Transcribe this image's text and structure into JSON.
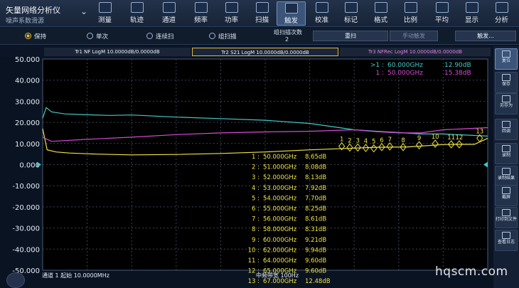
{
  "header": {
    "title": "矢量网络分析仪",
    "subtitle": "噪声系数滑源",
    "menu": [
      {
        "label": "测量",
        "icon": "measure-icon"
      },
      {
        "label": "轨迹",
        "icon": "trace-icon"
      },
      {
        "label": "通道",
        "icon": "channel-icon"
      },
      {
        "label": "频率",
        "icon": "frequency-icon"
      },
      {
        "label": "功率",
        "icon": "power-icon"
      },
      {
        "label": "扫描",
        "icon": "sweep-icon"
      },
      {
        "label": "触发",
        "icon": "trigger-icon",
        "active": true
      },
      {
        "label": "校准",
        "icon": "calibrate-icon"
      },
      {
        "label": "标记",
        "icon": "marker-icon"
      },
      {
        "label": "格式",
        "icon": "format-icon"
      },
      {
        "label": "比例",
        "icon": "scale-icon"
      },
      {
        "label": "平均",
        "icon": "average-icon"
      },
      {
        "label": "显示",
        "icon": "display-icon"
      },
      {
        "label": "分析",
        "icon": "analysis-icon"
      }
    ]
  },
  "trigger_bar": {
    "hold": "保持",
    "single": "单次",
    "continuous": "连续扫",
    "group": "组扫描",
    "group_count_label": "组扫描次数",
    "group_count_value": "2",
    "restart": "重扫",
    "manual": "手动触发",
    "trigger_more": "触发..."
  },
  "traces": {
    "tr1": "Tr1 NF LogM 10.0000dB/0.0000dB",
    "tr2": "Tr2 S21 LogM 10.0000dB/0.0000dB",
    "tr3": "Tr3 NFRec LogM 10.0000dB/0.0000dB"
  },
  "chart_data": {
    "type": "line",
    "ylim": [
      -50,
      50
    ],
    "y_ticks": [
      "50.000",
      "40.000",
      "30.000",
      "20.000",
      "10.000",
      "0.000",
      "-10.000",
      "-20.000",
      "-30.000",
      "-40.000",
      "-50.000"
    ],
    "reference_level": "0.000",
    "series": [
      {
        "name": "Tr1 NF",
        "color": "#f0e442",
        "start": "#f0e442",
        "points": [
          [
            0,
            17
          ],
          [
            0.01,
            7
          ],
          [
            0.03,
            6
          ],
          [
            0.06,
            5.5
          ],
          [
            0.12,
            5
          ],
          [
            0.2,
            4.6
          ],
          [
            0.3,
            4.8
          ],
          [
            0.4,
            5.3
          ],
          [
            0.5,
            6
          ],
          [
            0.6,
            7
          ],
          [
            0.7,
            7.8
          ],
          [
            0.75,
            8.2
          ],
          [
            0.82,
            8.4
          ],
          [
            0.9,
            9.5
          ],
          [
            0.95,
            9.6
          ],
          [
            0.97,
            9.6
          ],
          [
            1,
            12.5
          ]
        ]
      },
      {
        "name": "Tr2 S21",
        "color": "#45c8c8",
        "points": [
          [
            0,
            22
          ],
          [
            0.008,
            27
          ],
          [
            0.02,
            25
          ],
          [
            0.05,
            24
          ],
          [
            0.1,
            23.6
          ],
          [
            0.15,
            23.3
          ],
          [
            0.2,
            23.5
          ],
          [
            0.3,
            22.5
          ],
          [
            0.4,
            21.8
          ],
          [
            0.5,
            21
          ],
          [
            0.6,
            19.5
          ],
          [
            0.65,
            18
          ],
          [
            0.7,
            16.5
          ],
          [
            0.75,
            15.8
          ],
          [
            0.8,
            15.2
          ],
          [
            0.85,
            14.5
          ],
          [
            0.9,
            14.5
          ],
          [
            0.95,
            14
          ],
          [
            1,
            13.5
          ]
        ]
      },
      {
        "name": "Tr3 NFRec",
        "color": "#d44bd4",
        "points": [
          [
            0,
            13
          ],
          [
            0.02,
            11
          ],
          [
            0.1,
            12
          ],
          [
            0.2,
            13
          ],
          [
            0.3,
            14.2
          ],
          [
            0.4,
            15
          ],
          [
            0.5,
            15.5
          ],
          [
            0.6,
            15.8
          ],
          [
            0.7,
            16.5
          ],
          [
            0.75,
            15.6
          ],
          [
            0.8,
            15
          ],
          [
            0.85,
            15
          ],
          [
            0.9,
            16.5
          ],
          [
            0.95,
            17
          ],
          [
            1,
            17.5
          ]
        ]
      }
    ],
    "marker_readout": [
      {
        "id": "1",
        "freq": "50.000GHz",
        "value": "8.65dB"
      },
      {
        "id": "2",
        "freq": "51.000GHz",
        "value": "8.08dB"
      },
      {
        "id": "3",
        "freq": "52.000GHz",
        "value": "8.13dB"
      },
      {
        "id": "4",
        "freq": "53.000GHz",
        "value": "7.92dB"
      },
      {
        "id": "5",
        "freq": "54.000GHz",
        "value": "7.70dB"
      },
      {
        "id": "6",
        "freq": "55.000GHz",
        "value": "8.25dB"
      },
      {
        "id": "7",
        "freq": "56.000GHz",
        "value": "8.61dB"
      },
      {
        "id": "8",
        "freq": "58.000GHz",
        "value": "8.31dB"
      },
      {
        "id": "9",
        "freq": "60.000GHz",
        "value": "9.21dB"
      },
      {
        "id": "10",
        "freq": "62.000GHz",
        "value": "9.94dB"
      },
      {
        "id": "11",
        "freq": "64.000GHz",
        "value": "9.60dB"
      },
      {
        "id": "12",
        "freq": "65.000GHz",
        "value": "9.60dB"
      },
      {
        "id": "13",
        "freq": "67.000GHz",
        "value": "12.48dB"
      }
    ],
    "top_markers": [
      {
        "prefix": ">1",
        "freq": "60.000GHz",
        "value": "12.90dB",
        "color": "#45c8c8"
      },
      {
        "prefix": "1",
        "freq": "50.000GHz",
        "value": "15.38dB",
        "color": "#d44bd4"
      }
    ],
    "trace_markers": [
      {
        "label": "1",
        "x": 0.672,
        "y": 8.7
      },
      {
        "label": "2",
        "x": 0.69,
        "y": 8.1
      },
      {
        "label": "3",
        "x": 0.708,
        "y": 8.1
      },
      {
        "label": "4",
        "x": 0.726,
        "y": 7.9
      },
      {
        "label": "5",
        "x": 0.744,
        "y": 7.7
      },
      {
        "label": "6",
        "x": 0.762,
        "y": 8.3
      },
      {
        "label": "7",
        "x": 0.78,
        "y": 8.6
      },
      {
        "label": "8",
        "x": 0.81,
        "y": 8.3
      },
      {
        "label": "9",
        "x": 0.846,
        "y": 9.2
      },
      {
        "label": "10",
        "x": 0.882,
        "y": 9.9
      },
      {
        "label": "11",
        "x": 0.918,
        "y": 9.6
      },
      {
        "label": "12",
        "x": 0.936,
        "y": 9.6
      },
      {
        "label": "13",
        "x": 0.982,
        "y": 12.5
      }
    ]
  },
  "status": {
    "channel": "通道 1 起始 10.0000MHz",
    "ifbw": "中频带宽 100Hz"
  },
  "sidebar": [
    {
      "label": "复位",
      "icon": "reset-icon",
      "on": true
    },
    {
      "label": "保存",
      "icon": "save-icon"
    },
    {
      "label": "另存为",
      "icon": "save-as-icon"
    },
    {
      "label": "回调",
      "icon": "recall-icon"
    },
    {
      "label": "录制",
      "icon": "record-icon"
    },
    {
      "label": "录制结果",
      "icon": "record-result-icon"
    },
    {
      "label": "截屏",
      "icon": "screenshot-icon"
    },
    {
      "label": "打印到文件",
      "icon": "print-icon"
    },
    {
      "label": "查看日志",
      "icon": "log-icon"
    }
  ],
  "watermark": "hqscm.com"
}
